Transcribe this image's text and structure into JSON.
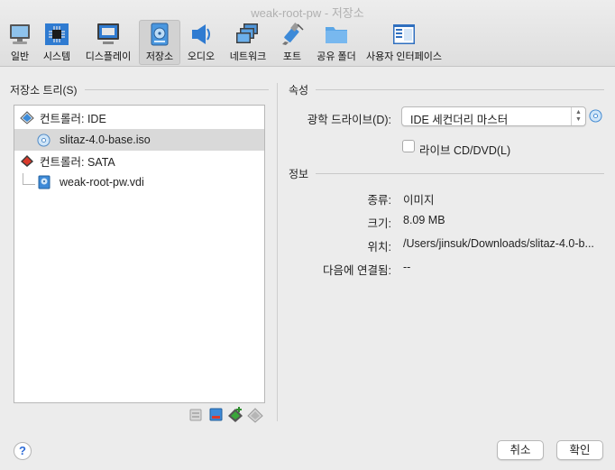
{
  "window": {
    "title": "weak-root-pw - 저장소"
  },
  "toolbar": {
    "items": [
      {
        "label": "일반",
        "icon": "monitor-icon"
      },
      {
        "label": "시스템",
        "icon": "chip-icon"
      },
      {
        "label": "디스플레이",
        "icon": "display-icon"
      },
      {
        "label": "저장소",
        "icon": "hard-disk-icon",
        "active": true
      },
      {
        "label": "오디오",
        "icon": "speaker-icon"
      },
      {
        "label": "네트워크",
        "icon": "network-icon"
      },
      {
        "label": "포트",
        "icon": "serial-port-icon"
      },
      {
        "label": "공유 폴더",
        "icon": "folder-icon"
      },
      {
        "label": "사용자 인터페이스",
        "icon": "window-icon"
      }
    ]
  },
  "storage_tree": {
    "heading": "저장소 트리(S)",
    "controllers": [
      {
        "label": "컨트롤러: IDE",
        "icon": "ide-controller-icon",
        "attachments": [
          {
            "label": "slitaz-4.0-base.iso",
            "icon": "optical-disc-icon",
            "selected": true
          }
        ]
      },
      {
        "label": "컨트롤러: SATA",
        "icon": "sata-controller-icon",
        "attachments": [
          {
            "label": "weak-root-pw.vdi",
            "icon": "hard-disk-file-icon",
            "selected": false
          }
        ]
      }
    ],
    "tools": [
      "add-attachment-icon",
      "remove-attachment-icon",
      "add-controller-icon",
      "remove-controller-icon"
    ]
  },
  "attributes": {
    "heading": "속성",
    "optical_drive_label": "광학 드라이브(D):",
    "optical_drive_value": "IDE 세컨더리 마스터",
    "live_cd_label": "라이브 CD/DVD(L)",
    "live_cd_checked": false
  },
  "information": {
    "heading": "정보",
    "type_label": "종류:",
    "type_value": "이미지",
    "size_label": "크기:",
    "size_value": "8.09 MB",
    "location_label": "위치:",
    "location_value": "/Users/jinsuk/Downloads/slitaz-4.0-b...",
    "attached_label": "다음에 연결됨:",
    "attached_value": "--"
  },
  "footer": {
    "help": "?",
    "cancel": "취소",
    "ok": "확인"
  }
}
